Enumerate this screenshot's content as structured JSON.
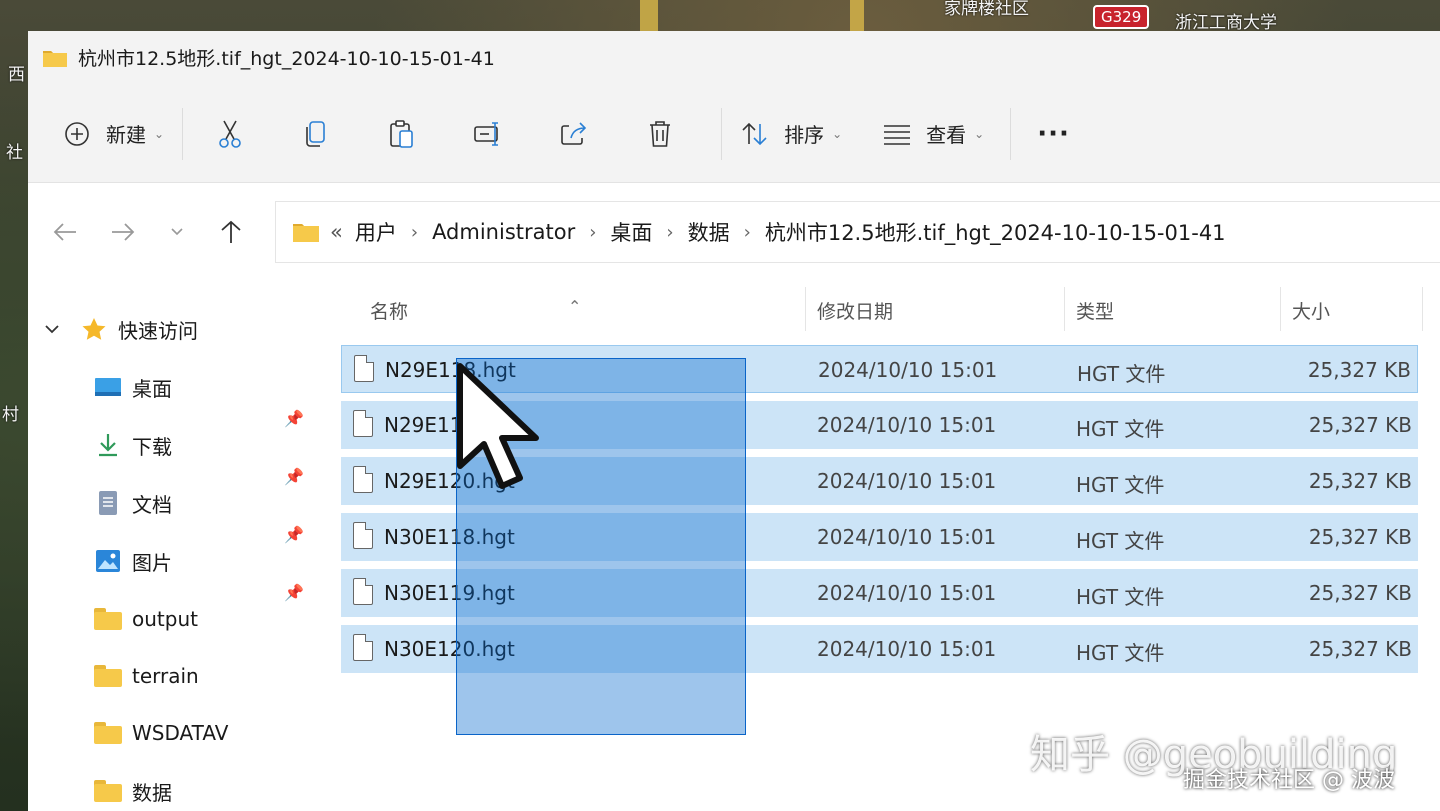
{
  "map": {
    "labels": [
      "家牌楼社区",
      "浙江工商大学",
      "西",
      "社",
      "村"
    ],
    "road_badge": "G329"
  },
  "window": {
    "title": "杭州市12.5地形.tif_hgt_2024-10-10-15-01-41"
  },
  "toolbar": {
    "new_label": "新建",
    "sort_label": "排序",
    "view_label": "查看",
    "more_label": "···",
    "icons": [
      "plus-circle-icon",
      "cut-icon",
      "copy-icon",
      "paste-icon",
      "rename-icon",
      "share-icon",
      "delete-icon",
      "sort-icon",
      "view-icon",
      "more-icon"
    ]
  },
  "address": {
    "overflow": "«",
    "crumbs": [
      "用户",
      "Administrator",
      "桌面",
      "数据",
      "杭州市12.5地形.tif_hgt_2024-10-10-15-01-41"
    ]
  },
  "sidebar": {
    "quick_access": "快速访问",
    "items": [
      {
        "label": "桌面",
        "icon": "desktop-icon",
        "pinned": true
      },
      {
        "label": "下载",
        "icon": "download-icon",
        "pinned": true
      },
      {
        "label": "文档",
        "icon": "document-icon",
        "pinned": true
      },
      {
        "label": "图片",
        "icon": "picture-icon",
        "pinned": true
      },
      {
        "label": "output",
        "icon": "folder-icon",
        "pinned": false
      },
      {
        "label": "terrain",
        "icon": "folder-icon",
        "pinned": false
      },
      {
        "label": "WSDATAV",
        "icon": "folder-icon",
        "pinned": false
      },
      {
        "label": "数据",
        "icon": "folder-icon",
        "pinned": false
      }
    ]
  },
  "columns": {
    "name": "名称",
    "modified": "修改日期",
    "type": "类型",
    "size": "大小"
  },
  "files": [
    {
      "name": "N29E118.hgt",
      "modified": "2024/10/10 15:01",
      "type": "HGT 文件",
      "size": "25,327 KB"
    },
    {
      "name": "N29E119.hgt",
      "modified": "2024/10/10 15:01",
      "type": "HGT 文件",
      "size": "25,327 KB"
    },
    {
      "name": "N29E120.hgt",
      "modified": "2024/10/10 15:01",
      "type": "HGT 文件",
      "size": "25,327 KB"
    },
    {
      "name": "N30E118.hgt",
      "modified": "2024/10/10 15:01",
      "type": "HGT 文件",
      "size": "25,327 KB"
    },
    {
      "name": "N30E119.hgt",
      "modified": "2024/10/10 15:01",
      "type": "HGT 文件",
      "size": "25,327 KB"
    },
    {
      "name": "N30E120.hgt",
      "modified": "2024/10/10 15:01",
      "type": "HGT 文件",
      "size": "25,327 KB"
    }
  ],
  "watermark": {
    "main": "知乎 @geobuilding",
    "sub": "掘金技术社区 @ 波波"
  },
  "colors": {
    "selection": "#cce4f7",
    "marquee": "#0a64c8",
    "folder": "#f6c94a"
  }
}
